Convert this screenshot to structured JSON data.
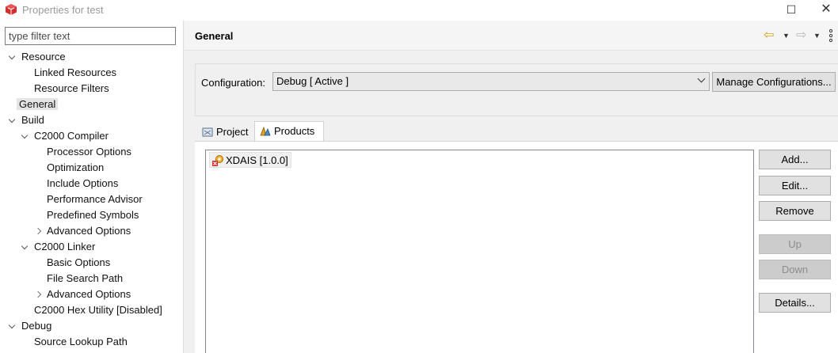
{
  "window": {
    "title": "Properties for test",
    "maximize_glyph": "☐",
    "close_glyph": "✕",
    "app_icon": "red-cube-icon"
  },
  "filter": {
    "placeholder": "type filter text"
  },
  "tree": {
    "items": [
      {
        "label": "Resource",
        "expanded": true
      },
      {
        "label": "Linked Resources"
      },
      {
        "label": "Resource Filters"
      },
      {
        "label": "General",
        "selected": true
      },
      {
        "label": "Build",
        "expanded": true
      },
      {
        "label": "C2000 Compiler",
        "expanded": true
      },
      {
        "label": "Processor Options"
      },
      {
        "label": "Optimization"
      },
      {
        "label": "Include Options"
      },
      {
        "label": "Performance Advisor"
      },
      {
        "label": "Predefined Symbols"
      },
      {
        "label": "Advanced Options",
        "collapsed": true
      },
      {
        "label": "C2000 Linker",
        "expanded": true
      },
      {
        "label": "Basic Options"
      },
      {
        "label": "File Search Path"
      },
      {
        "label": "Advanced Options",
        "collapsed": true
      },
      {
        "label": "C2000 Hex Utility  [Disabled]"
      },
      {
        "label": "Debug",
        "expanded": true
      },
      {
        "label": "Source Lookup Path"
      }
    ]
  },
  "header": {
    "title": "General",
    "back_icon": "back-arrow-icon",
    "forward_icon": "forward-arrow-icon",
    "menu_icon": "kebab-menu-icon"
  },
  "configuration": {
    "label": "Configuration:",
    "value": "Debug  [ Active ]",
    "manage_label": "Manage Configurations..."
  },
  "tabs": [
    {
      "label": "Project",
      "icon": "project-icon",
      "active": false
    },
    {
      "label": "Products",
      "icon": "products-icon",
      "active": true
    }
  ],
  "products": {
    "items": [
      {
        "label": "XDAIS  [1.0.0]",
        "icon": "product-error-icon"
      }
    ]
  },
  "buttons": {
    "add": "Add...",
    "edit": "Edit...",
    "remove": "Remove",
    "up": "Up",
    "down": "Down",
    "details": "Details..."
  },
  "colors": {
    "background": "#f0f0f0",
    "selection": "#e5e5e5",
    "back_arrow": "#d4a017",
    "disabled_text": "#8d8d8d"
  }
}
